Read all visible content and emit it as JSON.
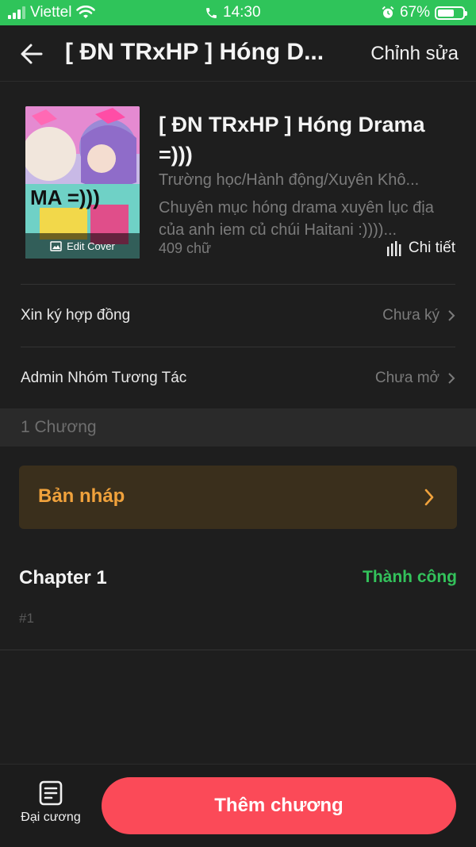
{
  "status": {
    "carrier": "Viettel",
    "time": "14:30",
    "battery": "67%",
    "battery_level": 0.67,
    "color": "#2fc45a"
  },
  "nav": {
    "title": "[ ĐN TRxHP ] Hóng D...",
    "edit_label": "Chỉnh sửa"
  },
  "story": {
    "title": "[ ĐN TRxHP ] Hóng Drama =)))",
    "genres": "Trường học/Hành động/Xuyên Khô...",
    "description": "Chuyên mục hóng drama xuyên lục địa của anh iem củ chúi Haitani :))))...",
    "word_count": "409 chữ",
    "detail_label": "Chi tiết",
    "cover_edit_label": "Edit Cover",
    "cover_text": "MA =)))"
  },
  "settings": [
    {
      "label": "Xin ký hợp đồng",
      "value": "Chưa ký"
    },
    {
      "label": "Admin Nhóm Tương Tác",
      "value": "Chưa mở"
    }
  ],
  "chapters_header": "1 Chương",
  "draft": {
    "label": "Bản nháp",
    "accent": "#f0a23c"
  },
  "chapter": {
    "title": "Chapter 1",
    "status": "Thành công",
    "number": "#1",
    "status_color": "#33c25b"
  },
  "bottom": {
    "outline_label": "Đại cương",
    "add_chapter_label": "Thêm chương",
    "add_color": "#fb4a58"
  }
}
